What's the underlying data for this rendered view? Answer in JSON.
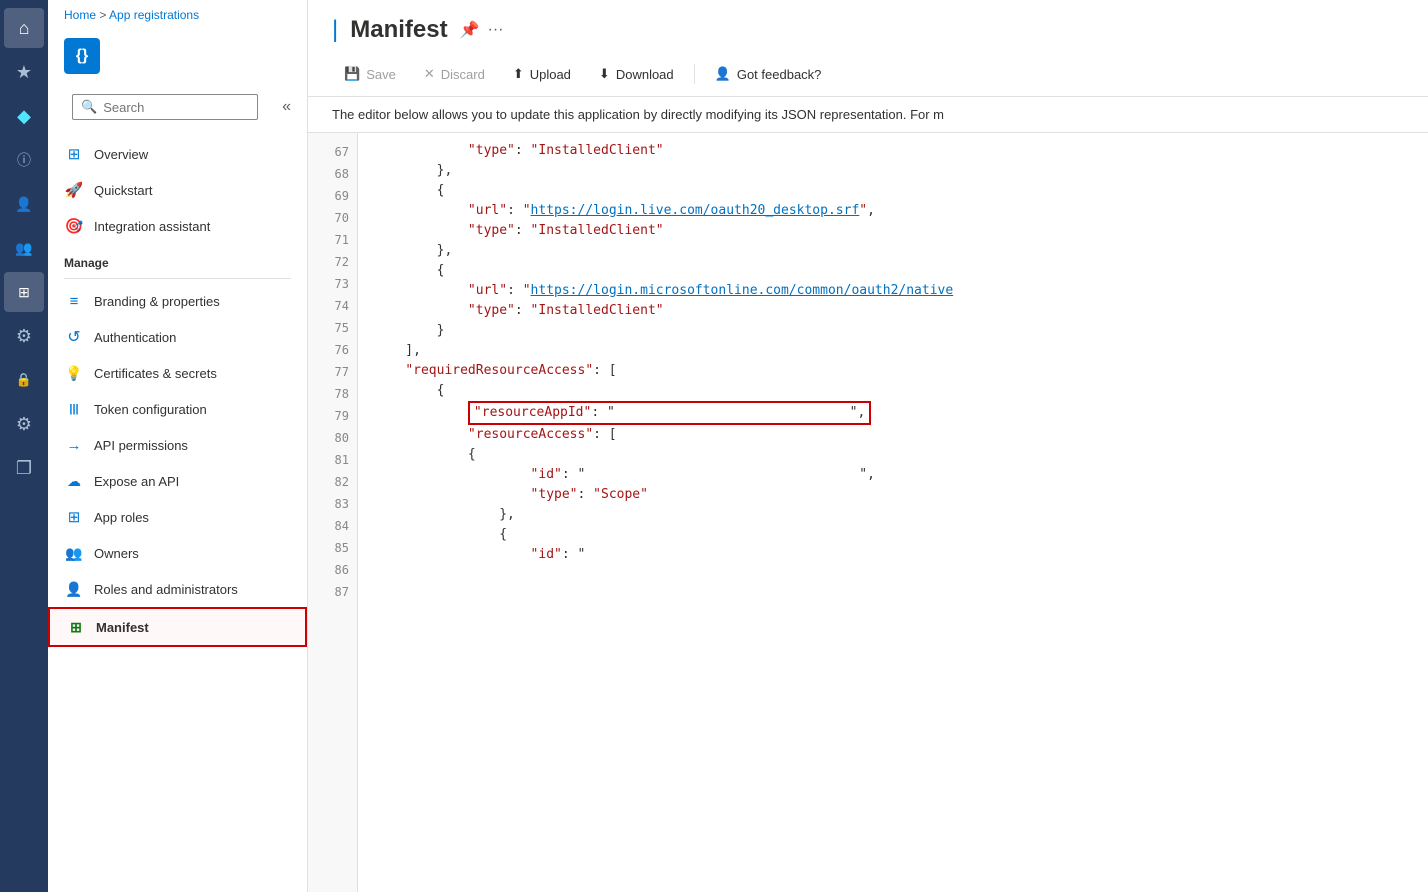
{
  "iconBar": {
    "items": [
      {
        "name": "home-icon",
        "icon": "⌂",
        "active": false
      },
      {
        "name": "star-icon",
        "icon": "★",
        "active": false
      },
      {
        "name": "diamond-icon",
        "icon": "◆",
        "active": false,
        "highlight": true
      },
      {
        "name": "info-icon",
        "icon": "ⓘ",
        "active": false
      },
      {
        "name": "user-icon",
        "icon": "👤",
        "active": false
      },
      {
        "name": "users-icon",
        "icon": "👥",
        "active": false
      },
      {
        "name": "grid-icon",
        "icon": "⊞",
        "active": true
      },
      {
        "name": "settings2-icon",
        "icon": "⚙",
        "active": false
      },
      {
        "name": "lock-icon",
        "icon": "🔒",
        "active": false
      },
      {
        "name": "settings3-icon",
        "icon": "⚙",
        "active": false
      },
      {
        "name": "copy-icon",
        "icon": "❐",
        "active": false
      }
    ]
  },
  "breadcrumb": {
    "home": "Home",
    "separator": " > ",
    "current": "App registrations"
  },
  "appIcon": {
    "symbol": "{}"
  },
  "search": {
    "placeholder": "Search"
  },
  "nav": {
    "items": [
      {
        "name": "overview",
        "label": "Overview",
        "icon": "⊞"
      },
      {
        "name": "quickstart",
        "label": "Quickstart",
        "icon": "🚀"
      },
      {
        "name": "integration-assistant",
        "label": "Integration assistant",
        "icon": "🎯"
      }
    ],
    "manageLabel": "Manage",
    "manageItems": [
      {
        "name": "branding",
        "label": "Branding & properties",
        "icon": "≡",
        "iconColor": "#0078d4"
      },
      {
        "name": "authentication",
        "label": "Authentication",
        "icon": "↺",
        "iconColor": "#0078d4"
      },
      {
        "name": "certificates",
        "label": "Certificates & secrets",
        "icon": "💡",
        "iconColor": "#f7a700"
      },
      {
        "name": "token-config",
        "label": "Token configuration",
        "icon": "|||",
        "iconColor": "#0078d4"
      },
      {
        "name": "api-permissions",
        "label": "API permissions",
        "icon": "→",
        "iconColor": "#0078d4"
      },
      {
        "name": "expose-api",
        "label": "Expose an API",
        "icon": "☁",
        "iconColor": "#0078d4"
      },
      {
        "name": "app-roles",
        "label": "App roles",
        "icon": "⊞",
        "iconColor": "#0078d4"
      },
      {
        "name": "owners",
        "label": "Owners",
        "icon": "👥",
        "iconColor": "#0078d4"
      },
      {
        "name": "roles-admins",
        "label": "Roles and administrators",
        "icon": "👤",
        "iconColor": "#0078d4"
      },
      {
        "name": "manifest",
        "label": "Manifest",
        "icon": "⊞",
        "iconColor": "#107c10",
        "active": true
      }
    ]
  },
  "page": {
    "title": "Manifest",
    "description": "The editor below allows you to update this application by directly modifying its JSON representation. For m"
  },
  "toolbar": {
    "saveLabel": "Save",
    "discardLabel": "Discard",
    "uploadLabel": "Upload",
    "downloadLabel": "Download",
    "feedbackLabel": "Got feedback?"
  },
  "code": {
    "lines": [
      {
        "num": "67",
        "content": "            \"type\": \"InstalledClient\""
      },
      {
        "num": "68",
        "content": "        },"
      },
      {
        "num": "69",
        "content": "        {"
      },
      {
        "num": "70",
        "content": "            \"url\": \"https://login.live.com/oauth20_desktop.srf\","
      },
      {
        "num": "71",
        "content": "            \"type\": \"InstalledClient\""
      },
      {
        "num": "72",
        "content": "        },"
      },
      {
        "num": "73",
        "content": "        {"
      },
      {
        "num": "74",
        "content": "            \"url\": \"https://login.microsoftonline.com/common/oauth2/native"
      },
      {
        "num": "75",
        "content": "            \"type\": \"InstalledClient\""
      },
      {
        "num": "76",
        "content": "        }"
      },
      {
        "num": "77",
        "content": "    ],"
      },
      {
        "num": "78",
        "content": "    \"requiredResourceAccess\": ["
      },
      {
        "num": "79",
        "content": "        {"
      },
      {
        "num": "80",
        "content": "            \"resourceAppId\": \"                               \",",
        "highlighted": true
      },
      {
        "num": "81",
        "content": "            \"resourceAccess\": ["
      },
      {
        "num": "82",
        "content": "            {"
      },
      {
        "num": "83",
        "content": "                    \"id\": \"                                   \","
      },
      {
        "num": "84",
        "content": "                    \"type\": \"Scope\""
      },
      {
        "num": "85",
        "content": "                },"
      },
      {
        "num": "86",
        "content": "                {"
      },
      {
        "num": "87",
        "content": "                    \"id\": \""
      }
    ]
  }
}
